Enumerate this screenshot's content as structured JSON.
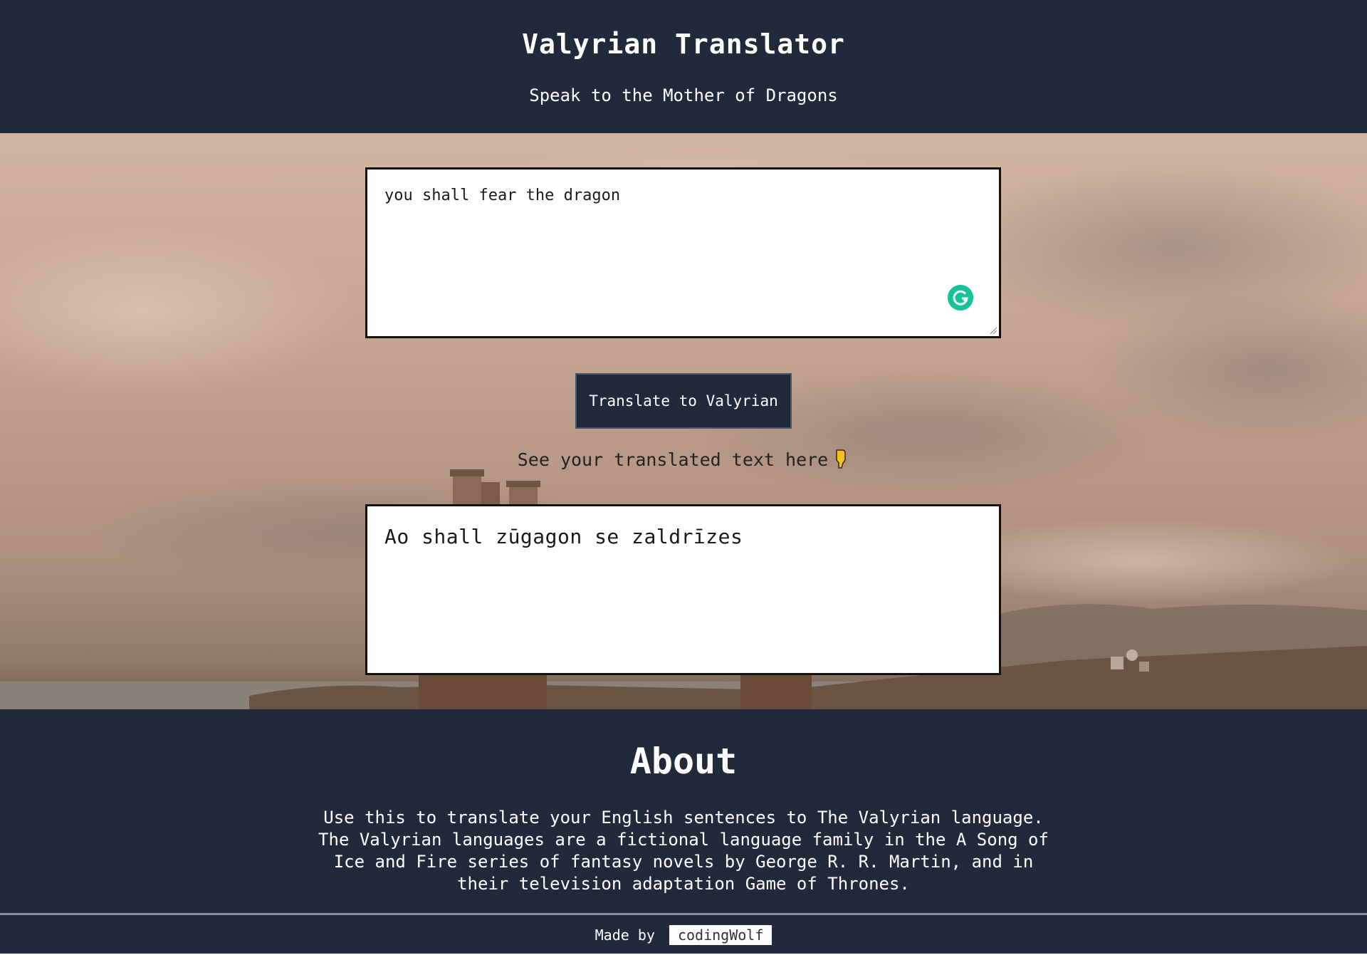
{
  "header": {
    "title": "Valyrian Translator",
    "subtitle": "Speak to the Mother of Dragons"
  },
  "translator": {
    "input_value": "you shall fear the dragon",
    "button_label": "Translate to Valyrian",
    "hint_text": "See your translated text here",
    "hint_icon": "pointing-down-hand-icon",
    "output_value": "Ao shall zūgagon se zaldrīzes",
    "extension_icon": "grammarly-icon"
  },
  "about": {
    "heading": "About",
    "text": "Use this to translate your English sentences to The Valyrian language. The Valyrian languages are a fictional language family in the A Song of Ice and Fire series of fantasy novels by George R. R. Martin, and in their television adaptation Game of Thrones."
  },
  "footer": {
    "made_by_label": "Made by",
    "author": "codingWolf"
  },
  "colors": {
    "navy": "#212a3b",
    "grammarly_green": "#15c39a",
    "hint_icon_yellow": "#f4c21f"
  }
}
